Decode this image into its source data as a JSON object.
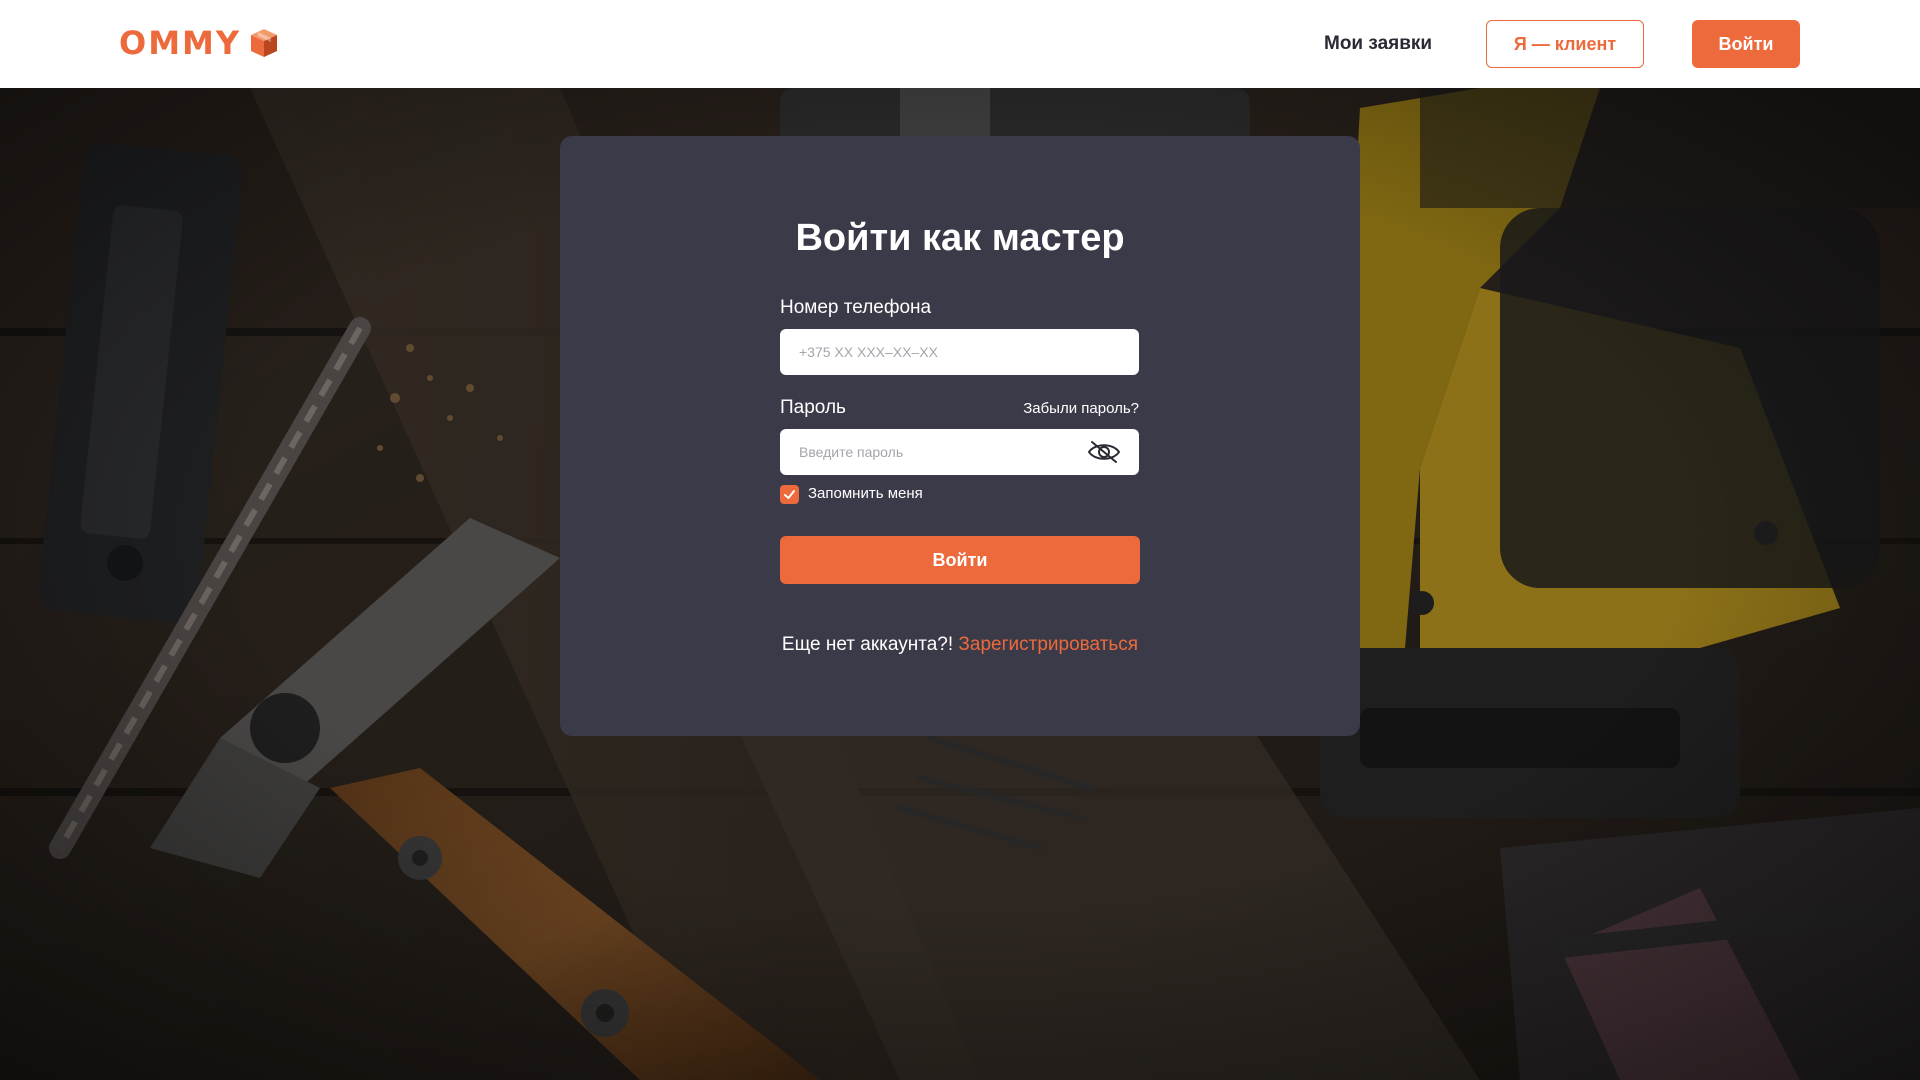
{
  "brand": {
    "name": "OMMY",
    "accent_color": "#ec6a3c",
    "logo_icon": "cube-icon"
  },
  "header": {
    "nav_my_requests": "Мои заявки",
    "client_button": "Я — клиент",
    "login_button": "Войти"
  },
  "form": {
    "title": "Войти как мастер",
    "phone": {
      "label": "Номер телефона",
      "placeholder": "+375 XX XXX–XX–XX",
      "value": ""
    },
    "password": {
      "label": "Пароль",
      "placeholder": "Введите пароль",
      "value": "",
      "toggle_icon": "eye-hidden-icon"
    },
    "forgot_password": "Забыли пароль?",
    "remember_me": {
      "label": "Запомнить меня",
      "checked": true
    },
    "submit_button": "Войти",
    "no_account_text": "Еще нет аккаунта?!",
    "register_link": "Зарегистрироваться"
  },
  "background": {
    "description_icon": "workshop-tools-background"
  }
}
